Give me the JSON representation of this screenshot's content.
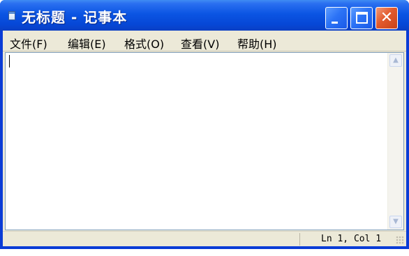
{
  "window": {
    "title": "无标题 - 记事本",
    "icon": "notepad-icon"
  },
  "title_buttons": {
    "minimize": "minimize-icon",
    "maximize": "maximize-icon",
    "close": "close-icon",
    "close_glyph": "✕"
  },
  "menu": {
    "items": [
      {
        "label": "文件(F)"
      },
      {
        "label": "编辑(E)"
      },
      {
        "label": "格式(O)"
      },
      {
        "label": "查看(V)"
      },
      {
        "label": "帮助(H)"
      }
    ]
  },
  "editor": {
    "content": ""
  },
  "scrollbar": {
    "up_glyph": "▲",
    "down_glyph": "▼"
  },
  "statusbar": {
    "position_text": "Ln 1, Col 1"
  },
  "colors": {
    "titlebar": "#0b55e3",
    "close_button": "#e25a2c",
    "frame": "#ece9d8"
  }
}
